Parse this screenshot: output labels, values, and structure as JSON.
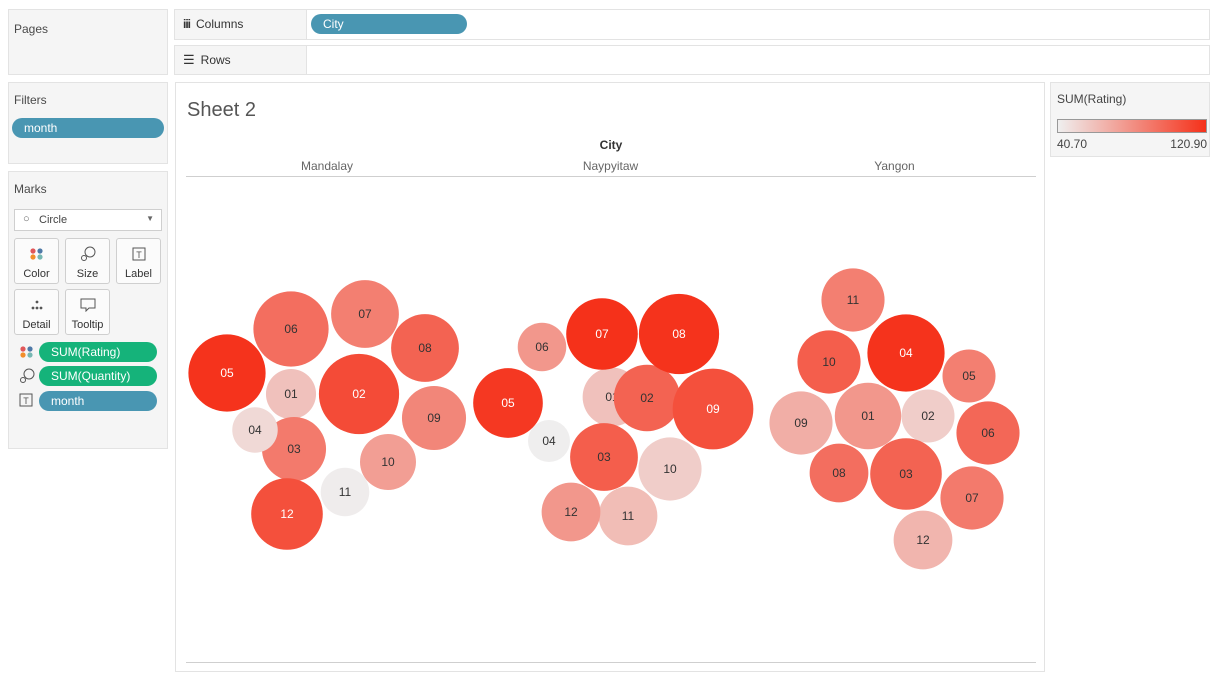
{
  "shelves": {
    "pages_label": "Pages",
    "columns_label": "Columns",
    "columns_pill": "City",
    "rows_label": "Rows"
  },
  "filters": {
    "title": "Filters",
    "pill": "month"
  },
  "marks": {
    "title": "Marks",
    "mark_type": "Circle",
    "buttons": {
      "color": "Color",
      "size": "Size",
      "label": "Label",
      "detail": "Detail",
      "tooltip": "Tooltip"
    },
    "fields": [
      {
        "label": "SUM(Rating)",
        "icon": "color-dots-icon",
        "color": "#15b37a"
      },
      {
        "label": "SUM(Quantity)",
        "icon": "size-icon",
        "color": "#15b37a"
      },
      {
        "label": "month",
        "icon": "label-icon",
        "color": "#4996b2"
      }
    ]
  },
  "sheet": {
    "title": "Sheet 2",
    "column_header": "City",
    "cities": [
      "Mandalay",
      "Naypyitaw",
      "Yangon"
    ]
  },
  "legend": {
    "title": "SUM(Rating)",
    "min_label": "40.70",
    "max_label": "120.90",
    "color_low": "#efefef",
    "color_high": "#f5311a"
  },
  "chart_data": {
    "type": "packed-bubble",
    "color_measure": "SUM(Rating)",
    "size_measure": "SUM(Quantity)",
    "label": "month",
    "color_range": [
      40.7,
      120.9
    ],
    "groups": [
      {
        "city": "Mandalay",
        "bubbles": [
          {
            "month": "01",
            "rating": 60,
            "quantity": 165
          },
          {
            "month": "02",
            "rating": 110,
            "quantity": 423
          },
          {
            "month": "03",
            "rating": 90,
            "quantity": 270
          },
          {
            "month": "04",
            "rating": 50,
            "quantity": 136
          },
          {
            "month": "05",
            "rating": 120,
            "quantity": 392
          },
          {
            "month": "06",
            "rating": 95,
            "quantity": 372
          },
          {
            "month": "07",
            "rating": 88,
            "quantity": 302
          },
          {
            "month": "08",
            "rating": 100,
            "quantity": 302
          },
          {
            "month": "09",
            "rating": 85,
            "quantity": 270
          },
          {
            "month": "10",
            "rating": 75,
            "quantity": 206
          },
          {
            "month": "11",
            "rating": 42,
            "quantity": 155
          },
          {
            "month": "12",
            "rating": 108,
            "quantity": 337
          }
        ]
      },
      {
        "city": "Naypyitaw",
        "bubbles": [
          {
            "month": "01",
            "rating": 60,
            "quantity": 227
          },
          {
            "month": "02",
            "rating": 100,
            "quantity": 290
          },
          {
            "month": "03",
            "rating": 102,
            "quantity": 302
          },
          {
            "month": "04",
            "rating": 41,
            "quantity": 116
          },
          {
            "month": "05",
            "rating": 118,
            "quantity": 319
          },
          {
            "month": "06",
            "rating": 78,
            "quantity": 155
          },
          {
            "month": "07",
            "rating": 120.9,
            "quantity": 337
          },
          {
            "month": "08",
            "rating": 120,
            "quantity": 423
          },
          {
            "month": "09",
            "rating": 108,
            "quantity": 428
          },
          {
            "month": "10",
            "rating": 55,
            "quantity": 262
          },
          {
            "month": "11",
            "rating": 62,
            "quantity": 227
          },
          {
            "month": "12",
            "rating": 78,
            "quantity": 227
          }
        ]
      },
      {
        "city": "Yangon",
        "bubbles": [
          {
            "month": "01",
            "rating": 78,
            "quantity": 290
          },
          {
            "month": "02",
            "rating": 55,
            "quantity": 185
          },
          {
            "month": "03",
            "rating": 100,
            "quantity": 337
          },
          {
            "month": "04",
            "rating": 120,
            "quantity": 392
          },
          {
            "month": "05",
            "rating": 88,
            "quantity": 185
          },
          {
            "month": "06",
            "rating": 98,
            "quantity": 262
          },
          {
            "month": "07",
            "rating": 90,
            "quantity": 262
          },
          {
            "month": "08",
            "rating": 95,
            "quantity": 227
          },
          {
            "month": "09",
            "rating": 68,
            "quantity": 262
          },
          {
            "month": "10",
            "rating": 102,
            "quantity": 262
          },
          {
            "month": "11",
            "rating": 88,
            "quantity": 262
          },
          {
            "month": "12",
            "rating": 65,
            "quantity": 227
          }
        ]
      }
    ]
  }
}
